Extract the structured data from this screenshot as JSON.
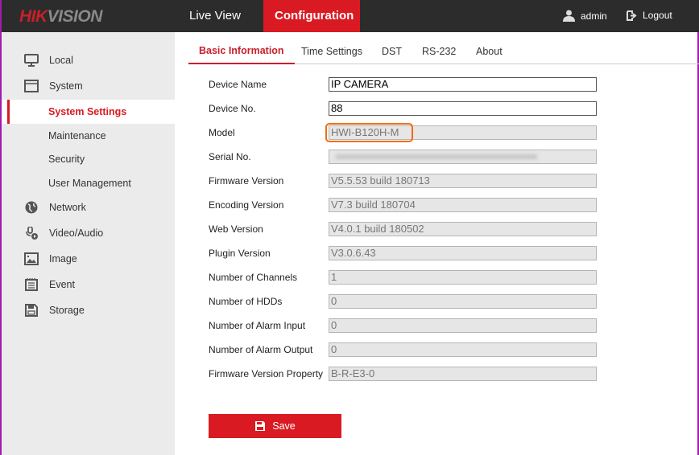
{
  "header": {
    "logo": "HIKVISION",
    "logo_red": "HIK",
    "logo_grey": "VISION",
    "nav": [
      "Live View",
      "Configuration"
    ],
    "user": "admin",
    "logout": "Logout"
  },
  "sidebar": {
    "items": [
      {
        "label": "Local",
        "icon": "monitor-icon"
      },
      {
        "label": "System",
        "icon": "window-icon"
      },
      {
        "label": "System Settings",
        "active": true
      },
      {
        "label": "Maintenance"
      },
      {
        "label": "Security"
      },
      {
        "label": "User Management"
      },
      {
        "label": "Network",
        "icon": "globe-icon"
      },
      {
        "label": "Video/Audio",
        "icon": "video-audio-icon"
      },
      {
        "label": "Image",
        "icon": "image-icon"
      },
      {
        "label": "Event",
        "icon": "event-icon"
      },
      {
        "label": "Storage",
        "icon": "storage-icon"
      }
    ]
  },
  "tabs": [
    "Basic Information",
    "Time Settings",
    "DST",
    "RS-232",
    "About"
  ],
  "fields": [
    {
      "label": "Device Name",
      "value": "IP CAMERA"
    },
    {
      "label": "Device No.",
      "value": "88"
    },
    {
      "label": "Model",
      "value": "HWI-B120H-M"
    },
    {
      "label": "Serial No.",
      "value": ""
    },
    {
      "label": "Firmware Version",
      "value": "V5.5.53 build 180713"
    },
    {
      "label": "Encoding Version",
      "value": "V7.3 build 180704"
    },
    {
      "label": "Web Version",
      "value": "V4.0.1 build 180502"
    },
    {
      "label": "Plugin Version",
      "value": "V3.0.6.43"
    },
    {
      "label": "Number of Channels",
      "value": "1"
    },
    {
      "label": "Number of HDDs",
      "value": "0"
    },
    {
      "label": "Number of Alarm Input",
      "value": "0"
    },
    {
      "label": "Number of Alarm Output",
      "value": "0"
    },
    {
      "label": "Firmware Version Property",
      "value": "B-R-E3-0"
    }
  ],
  "save_label": "Save",
  "colors": {
    "accent": "#da1a22",
    "highlight": "#f36c12"
  }
}
